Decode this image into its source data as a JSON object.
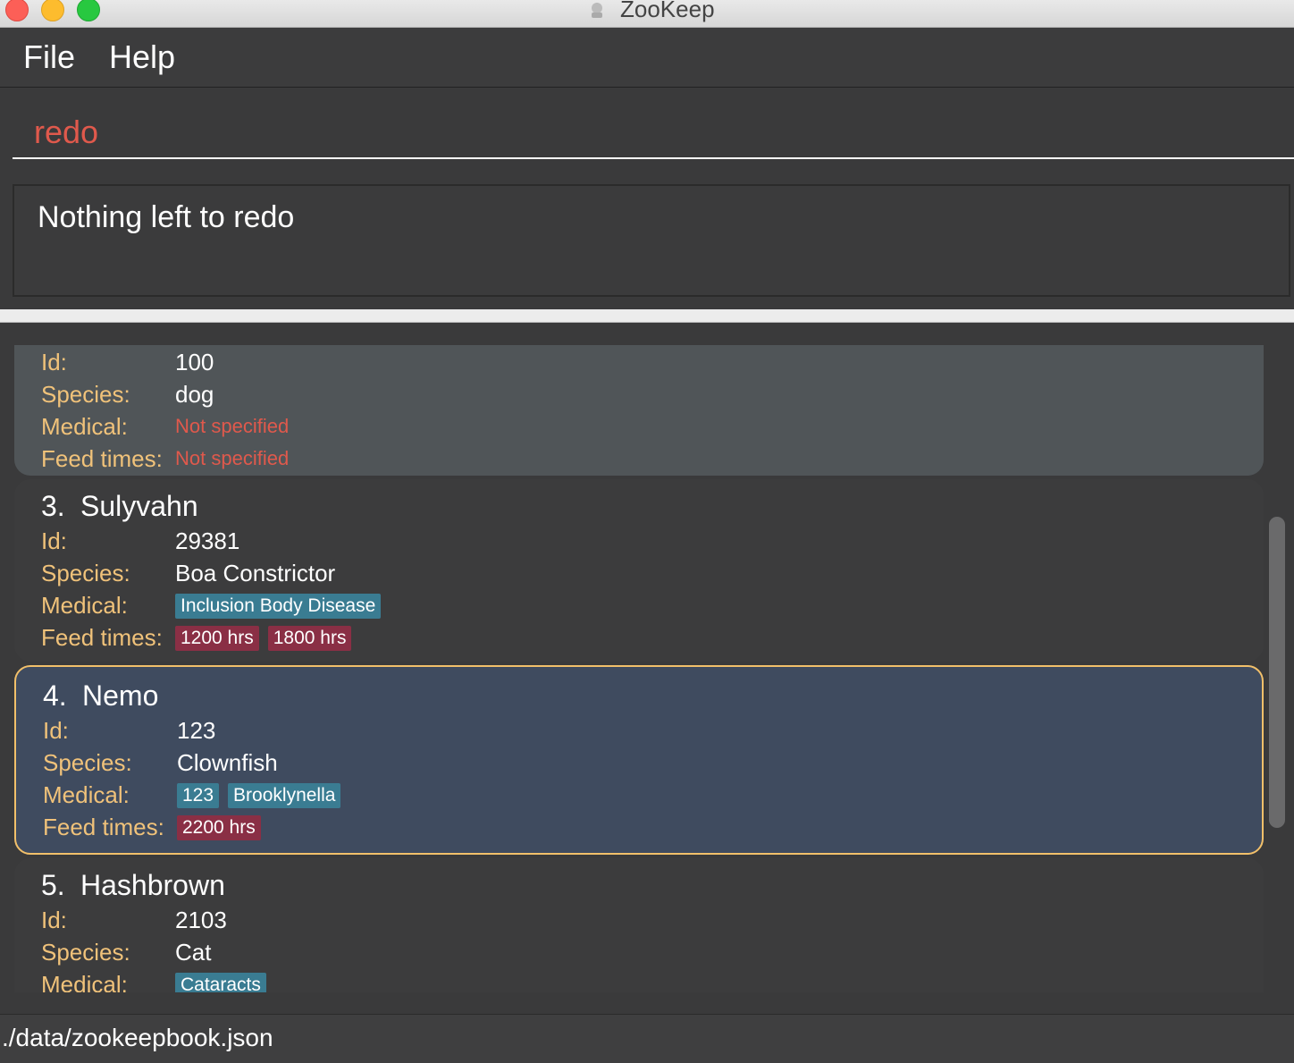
{
  "window": {
    "title": "ZooKeep"
  },
  "menu": {
    "file": "File",
    "help": "Help"
  },
  "command": {
    "value": "redo"
  },
  "result": {
    "message": "Nothing left to redo"
  },
  "animals": [
    {
      "index": "",
      "name": "",
      "id_label": "Id:",
      "id": "100",
      "species_label": "Species:",
      "species": "dog",
      "medical_label": "Medical:",
      "medical_missing": "Not specified",
      "feed_label": "Feed times:",
      "feed_missing": "Not specified"
    },
    {
      "index": "3.",
      "name": "Sulyvahn",
      "id_label": "Id:",
      "id": "29381",
      "species_label": "Species:",
      "species": "Boa Constrictor",
      "medical_label": "Medical:",
      "medical": [
        "Inclusion Body Disease"
      ],
      "feed_label": "Feed times:",
      "feed": [
        "1200 hrs",
        "1800 hrs"
      ]
    },
    {
      "index": "4.",
      "name": "Nemo",
      "id_label": "Id:",
      "id": "123",
      "species_label": "Species:",
      "species": "Clownfish",
      "medical_label": "Medical:",
      "medical": [
        "123",
        "Brooklynella"
      ],
      "feed_label": "Feed times:",
      "feed": [
        "2200 hrs"
      ]
    },
    {
      "index": "5.",
      "name": "Hashbrown",
      "id_label": "Id:",
      "id": "2103",
      "species_label": "Species:",
      "species": "Cat",
      "medical_label": "Medical:",
      "medical": [
        "Cataracts"
      ]
    }
  ],
  "status": {
    "file_path": "./data/zookeepbook.json"
  },
  "colors": {
    "label": "#f0c27a",
    "missing": "#e0594c",
    "medical_tag": "#3a7c92",
    "feed_tag": "#8a2f45",
    "selected_border": "#f2c06a"
  }
}
